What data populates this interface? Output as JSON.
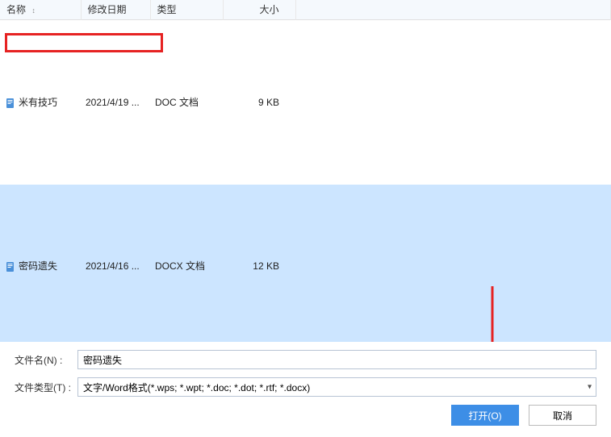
{
  "columns": {
    "name": "名称",
    "date": "修改日期",
    "type": "类型",
    "size": "大小"
  },
  "files": [
    {
      "name": "米有技巧",
      "date": "2021/4/19 ...",
      "type": "DOC 文档",
      "size": "9 KB",
      "selected": false
    },
    {
      "name": "密码遗失",
      "date": "2021/4/16 ...",
      "type": "DOCX 文档",
      "size": "12 KB",
      "selected": true
    }
  ],
  "form": {
    "filename_label": "文件名(N) :",
    "filename_value": "密码遗失",
    "filetype_label": "文件类型(T) :",
    "filetype_value": "文字/Word格式(*.wps; *.wpt; *.doc; *.dot; *.rtf; *.docx)"
  },
  "buttons": {
    "open": "打开(O)",
    "cancel": "取消"
  }
}
